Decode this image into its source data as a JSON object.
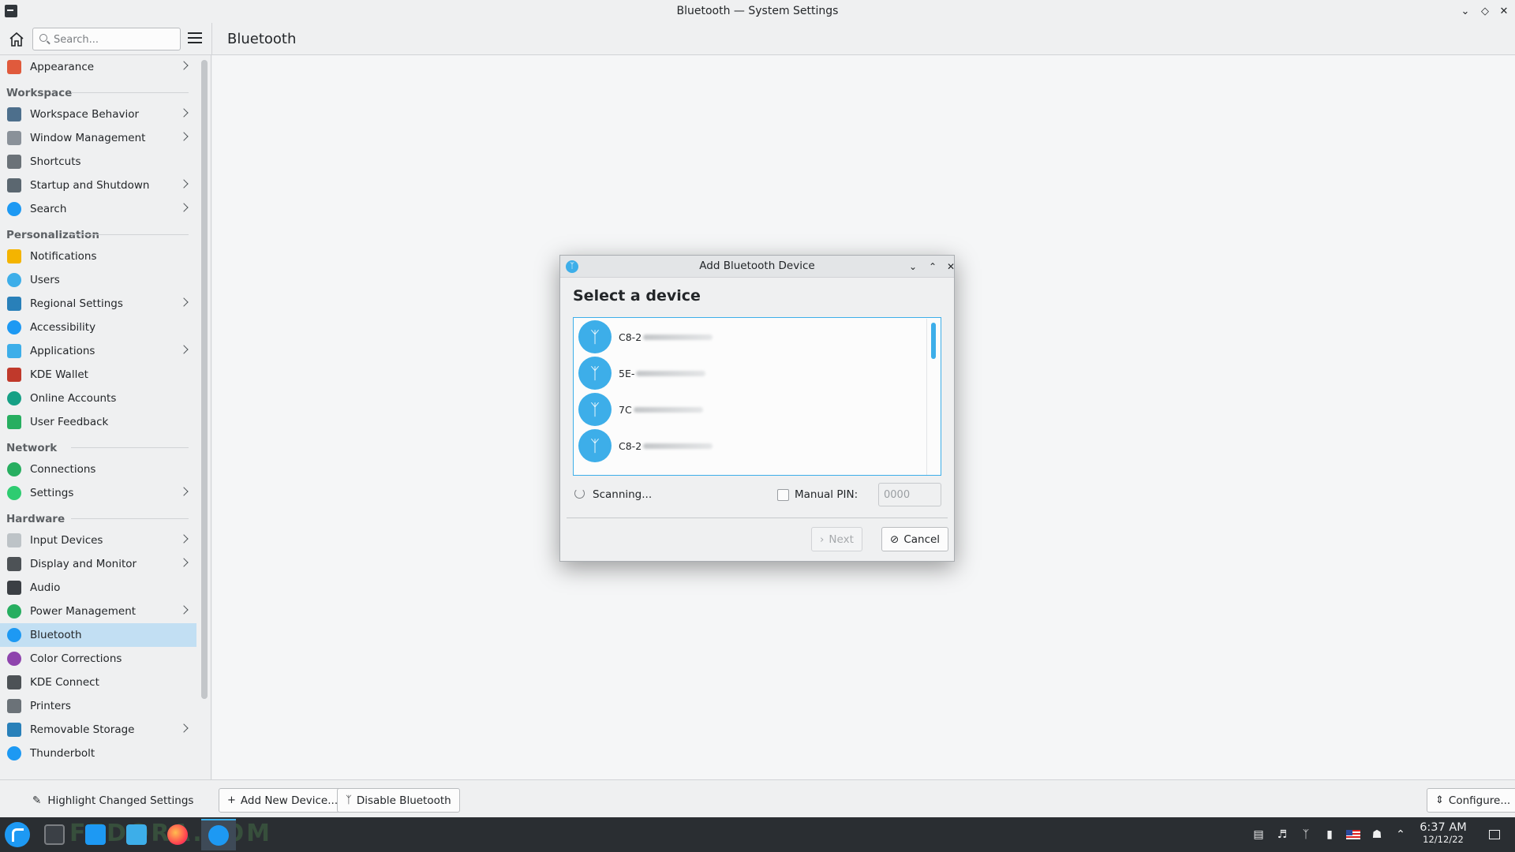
{
  "window": {
    "title": "Bluetooth — System Settings"
  },
  "header": {
    "search_placeholder": "Search...",
    "page_title": "Bluetooth"
  },
  "sidebar": {
    "items": [
      {
        "type": "item",
        "label": "Appearance",
        "icon": "appearance-icon",
        "color": "#e05a3c",
        "chevron": true
      },
      {
        "type": "section",
        "label": "Workspace"
      },
      {
        "type": "item",
        "label": "Workspace Behavior",
        "icon": "workspace-behavior-icon",
        "color": "#4d6f8c",
        "chevron": true
      },
      {
        "type": "item",
        "label": "Window Management",
        "icon": "window-management-icon",
        "color": "#8a9199",
        "chevron": true
      },
      {
        "type": "item",
        "label": "Shortcuts",
        "icon": "keyboard-icon",
        "color": "#6b7278",
        "chevron": false
      },
      {
        "type": "item",
        "label": "Startup and Shutdown",
        "icon": "startup-icon",
        "color": "#5b6770",
        "chevron": true
      },
      {
        "type": "item",
        "label": "Search",
        "icon": "search-icon",
        "color": "#1d99f3",
        "chevron": true
      },
      {
        "type": "section",
        "label": "Personalization"
      },
      {
        "type": "item",
        "label": "Notifications",
        "icon": "bell-icon",
        "color": "#f4b400",
        "chevron": false
      },
      {
        "type": "item",
        "label": "Users",
        "icon": "users-icon",
        "color": "#3daee9",
        "chevron": false
      },
      {
        "type": "item",
        "label": "Regional Settings",
        "icon": "regional-icon",
        "color": "#2980b9",
        "chevron": true
      },
      {
        "type": "item",
        "label": "Accessibility",
        "icon": "accessibility-icon",
        "color": "#1d99f3",
        "chevron": false
      },
      {
        "type": "item",
        "label": "Applications",
        "icon": "applications-icon",
        "color": "#3daee9",
        "chevron": true
      },
      {
        "type": "item",
        "label": "KDE Wallet",
        "icon": "wallet-icon",
        "color": "#c0392b",
        "chevron": false
      },
      {
        "type": "item",
        "label": "Online Accounts",
        "icon": "online-accounts-icon",
        "color": "#16a085",
        "chevron": false
      },
      {
        "type": "item",
        "label": "User Feedback",
        "icon": "feedback-icon",
        "color": "#27ae60",
        "chevron": false
      },
      {
        "type": "section",
        "label": "Network"
      },
      {
        "type": "item",
        "label": "Connections",
        "icon": "connections-icon",
        "color": "#27ae60",
        "chevron": false
      },
      {
        "type": "item",
        "label": "Settings",
        "icon": "network-settings-icon",
        "color": "#2ecc71",
        "chevron": true
      },
      {
        "type": "section",
        "label": "Hardware"
      },
      {
        "type": "item",
        "label": "Input Devices",
        "icon": "mouse-icon",
        "color": "#bdc3c7",
        "chevron": true
      },
      {
        "type": "item",
        "label": "Display and Monitor",
        "icon": "monitor-icon",
        "color": "#4d5256",
        "chevron": true
      },
      {
        "type": "item",
        "label": "Audio",
        "icon": "audio-icon",
        "color": "#3b3f44",
        "chevron": false
      },
      {
        "type": "item",
        "label": "Power Management",
        "icon": "power-icon",
        "color": "#27ae60",
        "chevron": true
      },
      {
        "type": "item",
        "label": "Bluetooth",
        "icon": "bluetooth-icon",
        "color": "#1d99f3",
        "chevron": false,
        "active": true
      },
      {
        "type": "item",
        "label": "Color Corrections",
        "icon": "color-icon",
        "color": "#8e44ad",
        "chevron": false
      },
      {
        "type": "item",
        "label": "KDE Connect",
        "icon": "kde-connect-icon",
        "color": "#4d5256",
        "chevron": false
      },
      {
        "type": "item",
        "label": "Printers",
        "icon": "printer-icon",
        "color": "#6b7278",
        "chevron": false
      },
      {
        "type": "item",
        "label": "Removable Storage",
        "icon": "usb-icon",
        "color": "#2980b9",
        "chevron": true
      },
      {
        "type": "item",
        "label": "Thunderbolt",
        "icon": "thunderbolt-icon",
        "color": "#1d99f3",
        "chevron": false
      }
    ]
  },
  "toolbar": {
    "highlight_label": "Highlight Changed Settings",
    "add_label": "Add New Device...",
    "disable_label": "Disable Bluetooth",
    "configure_label": "Configure..."
  },
  "dialog": {
    "title": "Add Bluetooth Device",
    "heading": "Select a device",
    "devices": [
      {
        "name": "C8-2"
      },
      {
        "name": "5E-"
      },
      {
        "name": "7C"
      },
      {
        "name": "C8-2"
      }
    ],
    "scanning_label": "Scanning...",
    "manual_pin_label": "Manual PIN:",
    "pin_placeholder": "0000",
    "next_label": "Next",
    "cancel_label": "Cancel"
  },
  "taskbar": {
    "watermark": "FEDORA.COM",
    "time": "6:37 AM",
    "date": "12/12/22"
  }
}
